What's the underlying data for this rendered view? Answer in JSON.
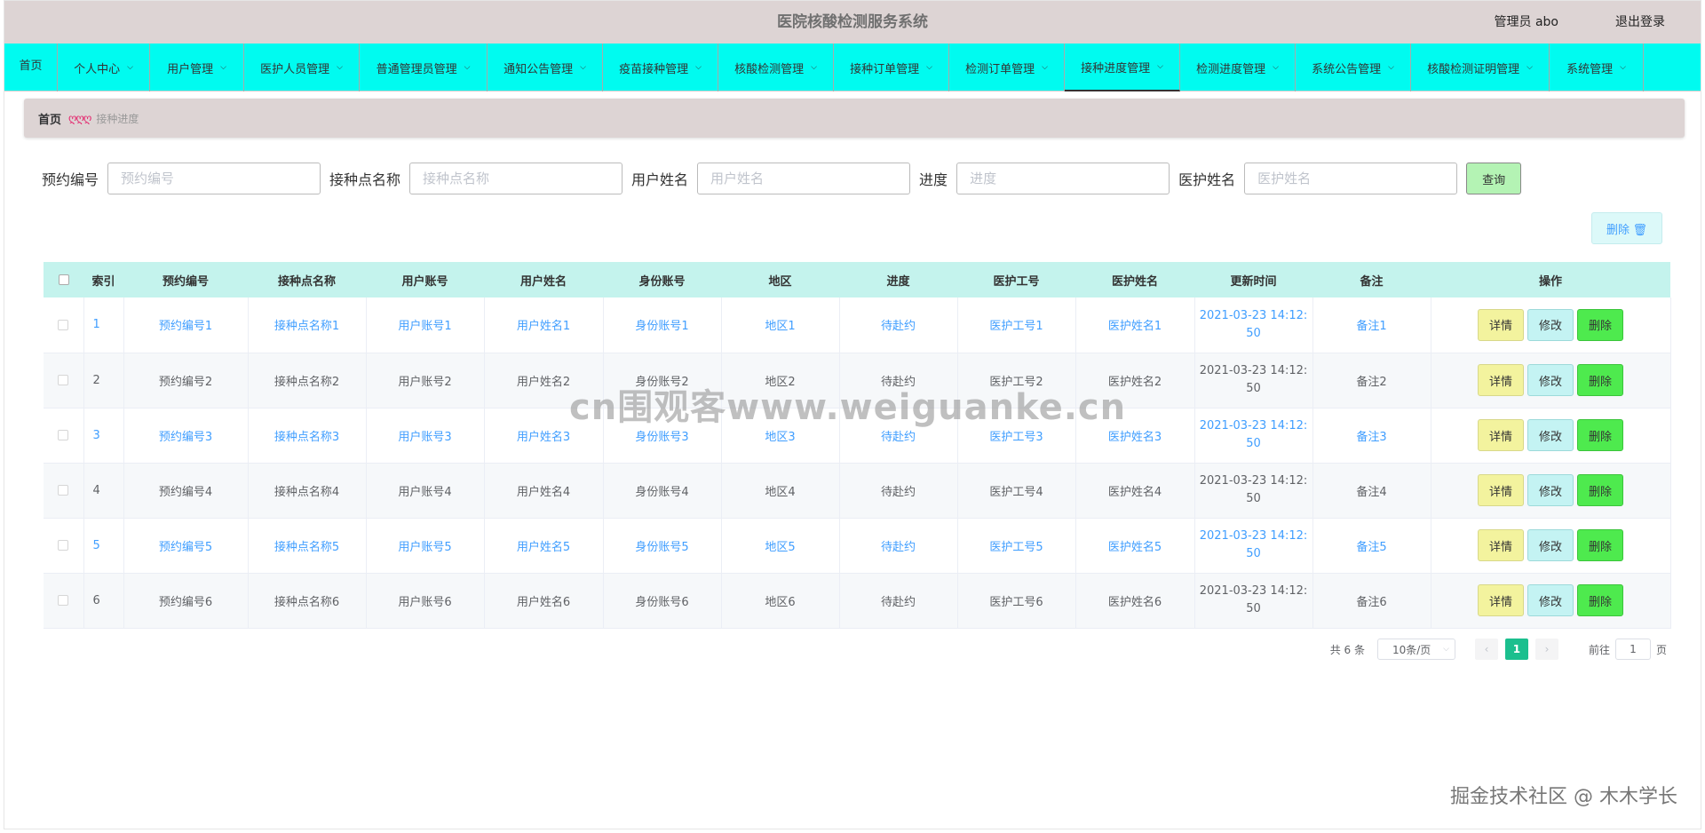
{
  "header": {
    "title": "医院核酸检测服务系统",
    "user": "管理员 abo",
    "logout": "退出登录"
  },
  "nav": {
    "home": "首页",
    "items": [
      {
        "label": "个人中心",
        "w": 104
      },
      {
        "label": "用户管理",
        "w": 106
      },
      {
        "label": "医护人员管理",
        "w": 130
      },
      {
        "label": "普通管理员管理",
        "w": 144
      },
      {
        "label": "通知公告管理",
        "w": 130
      },
      {
        "label": "疫苗接种管理",
        "w": 130
      },
      {
        "label": "核酸检测管理",
        "w": 130
      },
      {
        "label": "接种订单管理",
        "w": 130
      },
      {
        "label": "检测订单管理",
        "w": 130
      },
      {
        "label": "接种进度管理",
        "w": 130
      },
      {
        "label": "检测进度管理",
        "w": 130
      },
      {
        "label": "系统公告管理",
        "w": 130
      },
      {
        "label": "核酸检测证明管理",
        "w": 156
      },
      {
        "label": "系统管理",
        "w": 106
      }
    ]
  },
  "breadcrumb": {
    "home": "首页",
    "sep": "ღღღ",
    "current": "接种进度"
  },
  "search": {
    "f1_label": "预约编号",
    "f1_placeholder": "预约编号",
    "f2_label": "接种点名称",
    "f2_placeholder": "接种点名称",
    "f3_label": "用户姓名",
    "f3_placeholder": "用户姓名",
    "f4_label": "进度",
    "f4_placeholder": "进度",
    "f5_label": "医护姓名",
    "f5_placeholder": "医护姓名",
    "query": "查询"
  },
  "toolbar": {
    "delete": "删除 🗑"
  },
  "table": {
    "headers": [
      "",
      "索引",
      "预约编号",
      "接种点名称",
      "用户账号",
      "用户姓名",
      "身份账号",
      "地区",
      "进度",
      "医护工号",
      "医护姓名",
      "更新时间",
      "备注",
      "操作"
    ],
    "rows": [
      {
        "idx": "1",
        "no": "预约编号1",
        "site": "接种点名称1",
        "acct": "用户账号1",
        "name": "用户姓名1",
        "id": "身份账号1",
        "area": "地区1",
        "prog": "待赴约",
        "staffno": "医护工号1",
        "staff": "医护姓名1",
        "time1": "2021-03-23 14:12:",
        "time2": "50",
        "note": "备注1"
      },
      {
        "idx": "2",
        "no": "预约编号2",
        "site": "接种点名称2",
        "acct": "用户账号2",
        "name": "用户姓名2",
        "id": "身份账号2",
        "area": "地区2",
        "prog": "待赴约",
        "staffno": "医护工号2",
        "staff": "医护姓名2",
        "time1": "2021-03-23 14:12:",
        "time2": "50",
        "note": "备注2"
      },
      {
        "idx": "3",
        "no": "预约编号3",
        "site": "接种点名称3",
        "acct": "用户账号3",
        "name": "用户姓名3",
        "id": "身份账号3",
        "area": "地区3",
        "prog": "待赴约",
        "staffno": "医护工号3",
        "staff": "医护姓名3",
        "time1": "2021-03-23 14:12:",
        "time2": "50",
        "note": "备注3"
      },
      {
        "idx": "4",
        "no": "预约编号4",
        "site": "接种点名称4",
        "acct": "用户账号4",
        "name": "用户姓名4",
        "id": "身份账号4",
        "area": "地区4",
        "prog": "待赴约",
        "staffno": "医护工号4",
        "staff": "医护姓名4",
        "time1": "2021-03-23 14:12:",
        "time2": "50",
        "note": "备注4"
      },
      {
        "idx": "5",
        "no": "预约编号5",
        "site": "接种点名称5",
        "acct": "用户账号5",
        "name": "用户姓名5",
        "id": "身份账号5",
        "area": "地区5",
        "prog": "待赴约",
        "staffno": "医护工号5",
        "staff": "医护姓名5",
        "time1": "2021-03-23 14:12:",
        "time2": "50",
        "note": "备注5"
      },
      {
        "idx": "6",
        "no": "预约编号6",
        "site": "接种点名称6",
        "acct": "用户账号6",
        "name": "用户姓名6",
        "id": "身份账号6",
        "area": "地区6",
        "prog": "待赴约",
        "staffno": "医护工号6",
        "staff": "医护姓名6",
        "time1": "2021-03-23 14:12:",
        "time2": "50",
        "note": "备注6"
      }
    ],
    "ops": {
      "detail": "详情",
      "edit": "修改",
      "del": "删除"
    }
  },
  "pager": {
    "total": "共 6 条",
    "size": "10条/页",
    "page": "1",
    "goto": "前往",
    "goto_value": "1",
    "unit": "页"
  },
  "watermark": "cn围观客www.weiguanke.cn",
  "credit": "掘金技术社区 @ 木木学长"
}
